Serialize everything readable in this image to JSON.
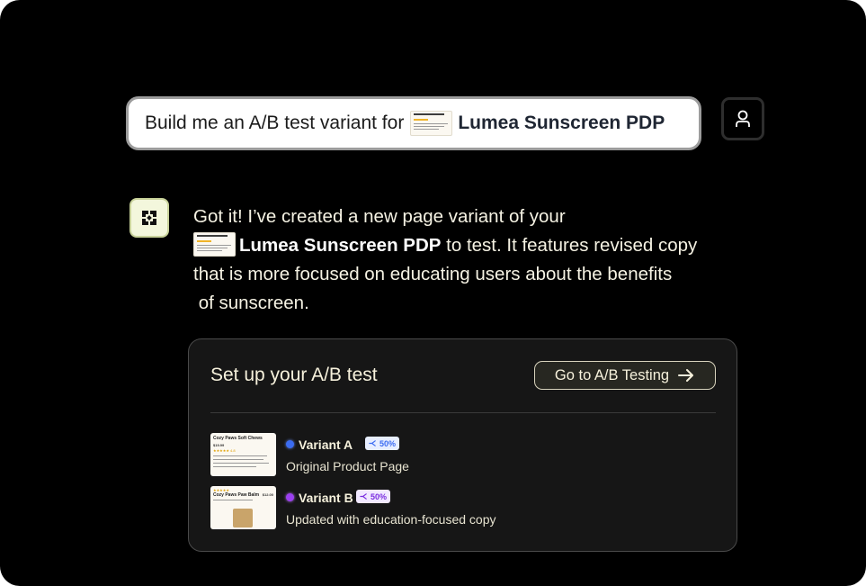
{
  "prompt": {
    "text": "Build me an A/B test variant for",
    "page_name": "Lumea Sunscreen PDP"
  },
  "user_button": {
    "icon": "user-icon"
  },
  "assistant": {
    "avatar_icon": "brand-logo-icon",
    "message": {
      "line1": "Got it! I’ve created a new page variant of your",
      "page_name": "Lumea Sunscreen PDP",
      "line2_rest": " to test. It features revised copy",
      "line3": "that is more focused on educating users about the benefits",
      "line4": " of sunscreen."
    }
  },
  "ab_card": {
    "title": "Set up your A/B test",
    "button_label": "Go to A/B Testing",
    "variants": [
      {
        "name": "Variant A",
        "split": "50%",
        "description": "Original Product Page",
        "dot_color": "#3b6cf2",
        "badge_color": "#3b6cf2",
        "thumb": {
          "title": "Cozy Paws Soft Chews",
          "price": "$19.99",
          "rating": "★★★★★ 4.8"
        }
      },
      {
        "name": "Variant B",
        "split": "50%",
        "description": "Updated with education-focused copy",
        "dot_color": "#9b3ff0",
        "badge_color": "#7b2ee0",
        "thumb": {
          "title": "Cozy Paws Paw Balm",
          "price": "$12.00",
          "rating": "★★★★★"
        }
      }
    ]
  },
  "colors": {
    "background": "#000000",
    "card_background": "#161616",
    "text_cream": "#f6f1dc",
    "avatar_bg": "#f3f7dc"
  }
}
